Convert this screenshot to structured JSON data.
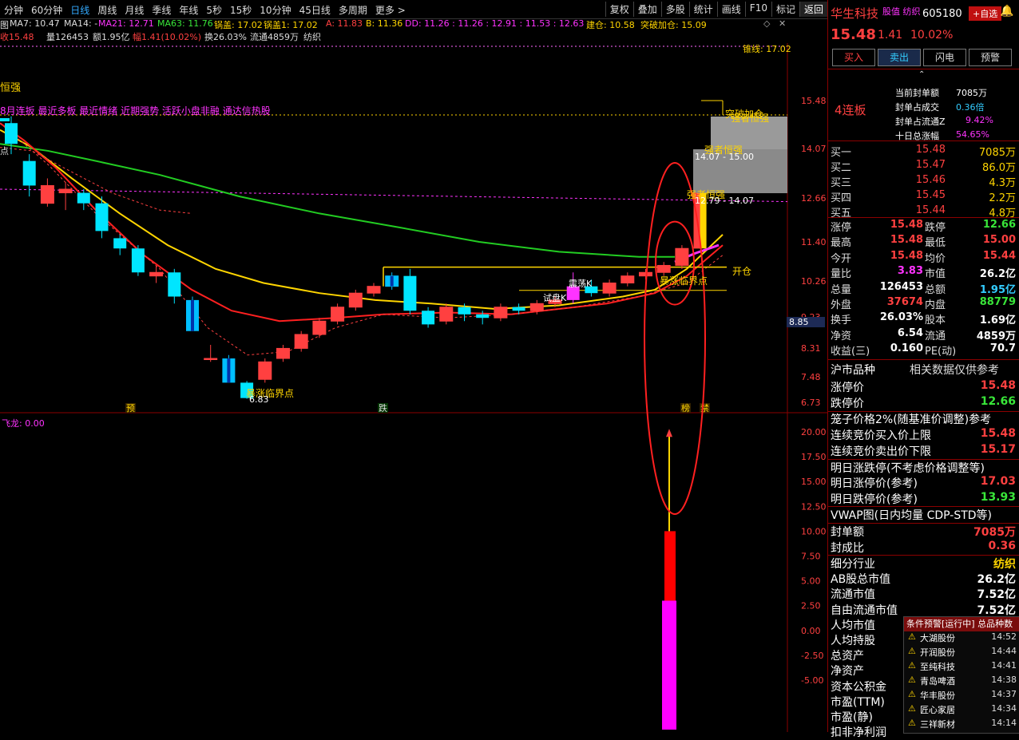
{
  "toolbar": {
    "periods": [
      "分钟",
      "60分钟",
      "日线",
      "周线",
      "月线",
      "季线",
      "年线",
      "5秒",
      "15秒",
      "10分钟",
      "45日线",
      "多周期",
      "更多 >"
    ],
    "active_period": "日线",
    "tools": [
      "复权",
      "叠加",
      "多股",
      "统计",
      "画线",
      "F10",
      "标记",
      "返回"
    ]
  },
  "indicators_row1": {
    "prefix": "图",
    "ma7": "MA7: 10.47",
    "ma14": "MA14: -",
    "ma21": "MA21: 12.71",
    "ma63": "MA63: 11.76",
    "guogai": "锅盖: 17.02",
    "guogai1": "锅盖1: 17.02",
    "a": "A: 11.83",
    "b": "B: 11.36",
    "dd": "DD: 11.26 : 11.26 : 12.91 : 11.53 : 12.63",
    "jiancang": "建仓: 10.58",
    "tupo": "突破加仓: 15.09"
  },
  "indicators_row2": {
    "close": "收15.48",
    "vol": "量126453",
    "amount": "额1.95亿",
    "pct": "幅1.41(10.02%)",
    "turnover": "换26.03%",
    "float": "流通4859万",
    "sector": "纺织"
  },
  "chart_labels": {
    "top_right": "锥线: 17.02",
    "strong": "恒强",
    "tags": "8月连扳 最近多板 最近情绪 近期强势 活跃小盘非融 通达信热股",
    "breakout1": "突破加仓",
    "strong1": "强者恒强",
    "strong2": "强者恒强",
    "strong3": "强者恒强",
    "box1": "14.07 - 15.00",
    "box2": "12.79 - 14.07",
    "kaicang": "开仓",
    "baozhang1": "暴涨临界点",
    "baozhang2": "暴涨临界点",
    "lowlabel": "6.83",
    "dian": "点",
    "zhen": "震",
    "qingqk": "震荡K",
    "qiwk": "试盘K",
    "cur_price": "8.85",
    "bottom_marks": [
      "预",
      "跌",
      "榜",
      "禁"
    ],
    "sub_title": "飞龙: 0.00"
  },
  "chart_data": {
    "type": "candlestick",
    "y_ticks_main": [
      "15.48",
      "14.07",
      "12.66",
      "11.40",
      "10.26",
      "9.23",
      "8.31",
      "7.48",
      "6.73"
    ],
    "y_ticks_sub": [
      "20.00",
      "17.50",
      "15.00",
      "12.50",
      "10.00",
      "7.50",
      "5.00",
      "2.50",
      "0.00",
      "-2.50",
      "-5.00"
    ],
    "candles": [
      {
        "o": 14.8,
        "c": 14.2,
        "h": 15.0,
        "l": 13.9
      },
      {
        "o": 13.7,
        "c": 13.0,
        "h": 13.9,
        "l": 12.7
      },
      {
        "o": 12.5,
        "c": 13.0,
        "h": 13.2,
        "l": 12.4
      },
      {
        "o": 12.8,
        "c": 12.9,
        "h": 13.1,
        "l": 12.3
      },
      {
        "o": 12.8,
        "c": 12.5,
        "h": 12.9,
        "l": 12.3
      },
      {
        "o": 12.5,
        "c": 11.7,
        "h": 12.7,
        "l": 11.5
      },
      {
        "o": 11.5,
        "c": 11.2,
        "h": 11.6,
        "l": 11.0
      },
      {
        "o": 11.2,
        "c": 10.5,
        "h": 11.3,
        "l": 10.4
      },
      {
        "o": 10.4,
        "c": 10.5,
        "h": 10.7,
        "l": 10.2
      },
      {
        "o": 10.5,
        "c": 9.8,
        "h": 10.6,
        "l": 9.6
      },
      {
        "o": 9.7,
        "c": 8.8,
        "h": 9.8,
        "l": 8.8
      },
      {
        "o": 8.0,
        "c": 8.0,
        "h": 8.4,
        "l": 7.9
      },
      {
        "o": 8.0,
        "c": 7.3,
        "h": 8.1,
        "l": 7.3
      },
      {
        "o": 7.3,
        "c": 6.85,
        "h": 7.35,
        "l": 6.83
      },
      {
        "o": 7.4,
        "c": 7.9,
        "h": 8.0,
        "l": 7.3
      },
      {
        "o": 8.0,
        "c": 8.3,
        "h": 8.4,
        "l": 7.9
      },
      {
        "o": 8.3,
        "c": 8.7,
        "h": 8.8,
        "l": 8.2
      },
      {
        "o": 8.7,
        "c": 9.1,
        "h": 9.2,
        "l": 8.6
      },
      {
        "o": 9.1,
        "c": 9.5,
        "h": 9.6,
        "l": 9.0
      },
      {
        "o": 9.5,
        "c": 9.9,
        "h": 10.0,
        "l": 9.4
      },
      {
        "o": 9.9,
        "c": 10.1,
        "h": 10.2,
        "l": 9.8
      },
      {
        "o": 10.1,
        "c": 10.4,
        "h": 10.5,
        "l": 10.0
      },
      {
        "o": 10.4,
        "c": 9.4,
        "h": 10.6,
        "l": 9.3
      },
      {
        "o": 9.4,
        "c": 9.0,
        "h": 9.5,
        "l": 8.9
      },
      {
        "o": 9.1,
        "c": 9.5,
        "h": 9.6,
        "l": 9.0
      },
      {
        "o": 9.5,
        "c": 9.3,
        "h": 9.6,
        "l": 9.1
      },
      {
        "o": 9.3,
        "c": 9.2,
        "h": 9.4,
        "l": 9.0
      },
      {
        "o": 9.2,
        "c": 9.5,
        "h": 9.6,
        "l": 9.1
      },
      {
        "o": 9.5,
        "c": 9.4,
        "h": 9.6,
        "l": 9.3
      },
      {
        "o": 9.4,
        "c": 9.6,
        "h": 9.7,
        "l": 9.3
      },
      {
        "o": 9.6,
        "c": 9.7,
        "h": 9.8,
        "l": 9.5
      },
      {
        "o": 9.7,
        "c": 10.1,
        "h": 10.5,
        "l": 9.6
      },
      {
        "o": 10.1,
        "c": 9.9,
        "h": 10.3,
        "l": 9.8
      },
      {
        "o": 9.9,
        "c": 10.2,
        "h": 10.3,
        "l": 9.8
      },
      {
        "o": 10.2,
        "c": 10.4,
        "h": 10.5,
        "l": 10.1
      },
      {
        "o": 10.4,
        "c": 10.5,
        "h": 10.6,
        "l": 10.3
      },
      {
        "o": 10.5,
        "c": 10.7,
        "h": 10.8,
        "l": 10.4
      },
      {
        "o": 10.7,
        "c": 11.2,
        "h": 11.3,
        "l": 10.6
      },
      {
        "o": 11.2,
        "c": 12.8,
        "h": 12.8,
        "l": 11.2
      }
    ]
  },
  "right_panel": {
    "name": "华生科技",
    "tags": "股值 纺织",
    "code": "605180",
    "add_btn": "+自选",
    "price": "15.48",
    "change": "1.41",
    "pct": "10.02%",
    "buttons": [
      "买入",
      "卖出",
      "闪电",
      "预警"
    ],
    "lianban": "4连板",
    "seal": [
      {
        "l": "当前封单额",
        "v": "7085万"
      },
      {
        "l": "封单占成交",
        "v": "0.36倍"
      },
      {
        "l": "封单占流通Z",
        "v": "9.42%"
      },
      {
        "l": "十日总涨幅",
        "v": "54.65%"
      }
    ],
    "quotes": [
      {
        "l": "买一",
        "p": "15.48",
        "v": "7085万"
      },
      {
        "l": "买二",
        "p": "15.47",
        "v": "86.0万"
      },
      {
        "l": "买三",
        "p": "15.46",
        "v": "4.3万"
      },
      {
        "l": "买四",
        "p": "15.45",
        "v": "2.2万"
      },
      {
        "l": "买五",
        "p": "15.44",
        "v": "4.8万"
      }
    ],
    "stats": [
      {
        "l1": "涨停",
        "v1": "15.48",
        "c1": "red",
        "l2": "跌停",
        "v2": "12.66",
        "c2": "grn"
      },
      {
        "l1": "最高",
        "v1": "15.48",
        "c1": "red",
        "l2": "最低",
        "v2": "15.00",
        "c2": "red"
      },
      {
        "l1": "今开",
        "v1": "15.48",
        "c1": "red",
        "l2": "均价",
        "v2": "15.44",
        "c2": "red"
      },
      {
        "l1": "量比",
        "v1": "3.83",
        "c1": "mag",
        "l2": "市值",
        "v2": "26.2亿",
        "c2": "wht"
      },
      {
        "l1": "总量",
        "v1": "126453",
        "c1": "wht",
        "l2": "总额",
        "v2": "1.95亿",
        "c2": "cyn"
      },
      {
        "l1": "外盘",
        "v1": "37674",
        "c1": "red",
        "l2": "内盘",
        "v2": "88779",
        "c2": "grn"
      },
      {
        "l1": "换手",
        "v1": "26.03%",
        "c1": "wht",
        "l2": "股本",
        "v2": "1.69亿",
        "c2": "wht"
      },
      {
        "l1": "净资",
        "v1": "6.54",
        "c1": "wht",
        "l2": "流通",
        "v2": "4859万",
        "c2": "wht"
      },
      {
        "l1": "收益(三)",
        "v1": "0.160",
        "c1": "wht",
        "l2": "PE(动)",
        "v2": "70.7",
        "c2": "wht"
      }
    ],
    "market_title": "沪市品种",
    "market_note": "相关数据仅供参考",
    "limit_rows": [
      {
        "l": "涨停价",
        "v": "15.48",
        "c": "red"
      },
      {
        "l": "跌停价",
        "v": "12.66",
        "c": "grn"
      }
    ],
    "cage": "笼子价格2%(随基准价调整)参考",
    "auction": [
      {
        "l": "连续竞价买入价上限",
        "v": "15.48",
        "c": "red"
      },
      {
        "l": "连续竞价卖出价下限",
        "v": "15.17",
        "c": "red"
      }
    ],
    "next_title": "明日涨跌停(不考虑价格调整等)",
    "next": [
      {
        "l": "明日涨停价(参考)",
        "v": "17.03",
        "c": "red"
      },
      {
        "l": "明日跌停价(参考)",
        "v": "13.93",
        "c": "grn"
      }
    ],
    "vwap": "VWAP图(日内均量 CDP-STD等)",
    "seal2": [
      {
        "l": "封单额",
        "v": "7085万",
        "c": "red"
      },
      {
        "l": "封成比",
        "v": "0.36",
        "c": "red"
      }
    ],
    "fin": [
      {
        "l": "细分行业",
        "v": "纺织",
        "c": "yel"
      },
      {
        "l": "AB股总市值",
        "v": "26.2亿",
        "c": "wht"
      },
      {
        "l": "流通市值",
        "v": "7.52亿",
        "c": "wht"
      },
      {
        "l": "自由流通市值",
        "v": "7.52亿",
        "c": "wht"
      },
      {
        "l": "人均市值",
        "v": "",
        "c": "wht"
      },
      {
        "l": "人均持股",
        "v": "",
        "c": "wht"
      },
      {
        "l": "总资产",
        "v": "",
        "c": "wht"
      },
      {
        "l": "净资产",
        "v": "",
        "c": "wht"
      },
      {
        "l": "资本公积金",
        "v": "",
        "c": "wht"
      },
      {
        "l": "市盈(TTM)",
        "v": "",
        "c": "wht"
      },
      {
        "l": "市盈(静)",
        "v": "",
        "c": "wht"
      },
      {
        "l": "扣非净利润",
        "v": "",
        "c": "wht"
      }
    ]
  },
  "alert": {
    "title": "条件预警[运行中] 总品种数",
    "items": [
      {
        "n": "大湖股份",
        "t": "14:52"
      },
      {
        "n": "开润股份",
        "t": "14:44"
      },
      {
        "n": "至纯科技",
        "t": "14:41"
      },
      {
        "n": "青岛啤酒",
        "t": "14:38"
      },
      {
        "n": "华丰股份",
        "t": "14:37"
      },
      {
        "n": "匠心家居",
        "t": "14:34"
      },
      {
        "n": "三祥新材",
        "t": "14:14"
      }
    ]
  }
}
